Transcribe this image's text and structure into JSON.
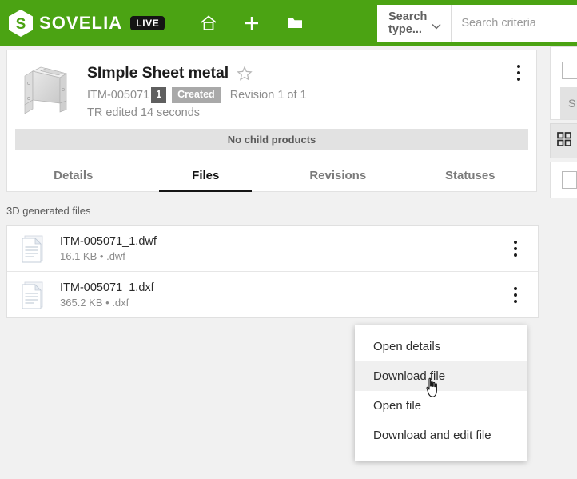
{
  "brand": {
    "logo_letter": "S",
    "name": "SOVELIA",
    "live_badge": "LIVE",
    "green": "#4ba313"
  },
  "topbar": {
    "icons": [
      {
        "name": "home-icon",
        "label": "Home"
      },
      {
        "name": "plus-icon",
        "label": "New"
      },
      {
        "name": "folder-icon",
        "label": "Folders"
      }
    ],
    "search_type_label": "Search type...",
    "search_criteria_placeholder": "Search criteria",
    "search_criteria_value": ""
  },
  "product": {
    "title": "SImple Sheet metal",
    "item_code": "ITM-005071",
    "revision_badge": "1",
    "status_badge": "Created",
    "revision_text": "Revision 1 of 1",
    "edited_text": "TR edited 14 seconds",
    "child_products_text": "No child products",
    "favorite_icon": "star-outline-icon",
    "more_icon": "kebab-menu-icon"
  },
  "tabs": [
    {
      "label": "Details",
      "active": false
    },
    {
      "label": "Files",
      "active": true
    },
    {
      "label": "Revisions",
      "active": false
    },
    {
      "label": "Statuses",
      "active": false
    }
  ],
  "files_section": {
    "heading": "3D generated files",
    "items": [
      {
        "name": "ITM-005071_1.dwf",
        "size": "16.1 KB",
        "separator": "•",
        "ext": ".dwf"
      },
      {
        "name": "ITM-005071_1.dxf",
        "size": "365.2 KB",
        "separator": "•",
        "ext": ".dxf"
      }
    ]
  },
  "context_menu": {
    "items": [
      {
        "label": "Open details",
        "hovered": false
      },
      {
        "label": "Download file",
        "hovered": true
      },
      {
        "label": "Open file",
        "hovered": false
      },
      {
        "label": "Download and edit file",
        "hovered": false
      }
    ]
  },
  "right_panel": {
    "button_label": "S",
    "grid_icon": "grid-apps-icon"
  }
}
